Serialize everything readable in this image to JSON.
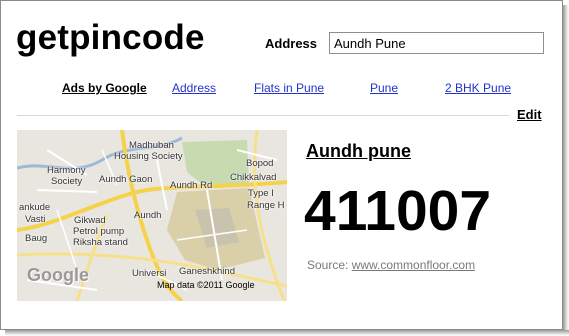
{
  "header": {
    "logo": "getpincode",
    "address_label": "Address",
    "address_value": "Aundh Pune"
  },
  "ads": {
    "title": "Ads by Google",
    "links": [
      "Address",
      "Flats in Pune",
      "Pune",
      "2 BHK Pune"
    ]
  },
  "edit_label": "Edit",
  "map": {
    "labels": [
      "Madhuban",
      "Housing Society",
      "Bopod",
      "Harmony",
      "Society",
      "Aundh Gaon",
      "Chikkalvad",
      "Aundh Rd",
      "Type I",
      "ankude",
      "Range H",
      "Vasti",
      "Gikwad",
      "Aundh",
      "Petrol pump",
      "Baug",
      "Riksha stand",
      "Universi",
      "Ganeshkhind"
    ],
    "google_logo": "Google",
    "attribution": "Map data ©2011 Google"
  },
  "result": {
    "area_name": "Aundh pune",
    "pincode": "411007",
    "source_label": "Source:",
    "source_link": "www.commonfloor.com"
  }
}
